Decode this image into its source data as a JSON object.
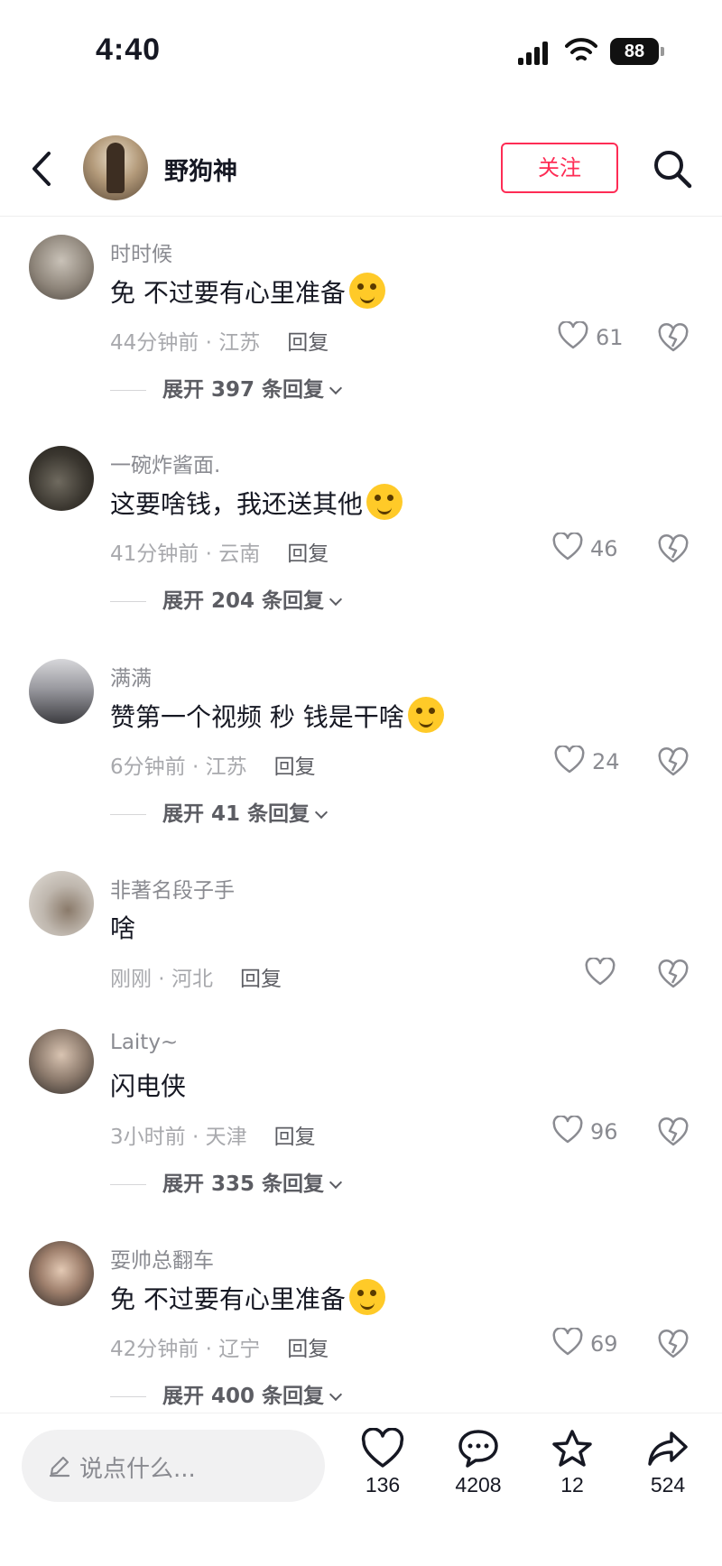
{
  "status_bar": {
    "time": "4:40",
    "battery": "88"
  },
  "header": {
    "title": "野狗神",
    "follow_label": "关注"
  },
  "comments": [
    {
      "username": "时时候",
      "content": "免 不过要有心里准备",
      "emoji": true,
      "time": "44分钟前",
      "location": "江苏",
      "reply_label": "回复",
      "likes": "61",
      "expand_label": "展开 397 条回复"
    },
    {
      "username": "一碗炸酱面.",
      "content": "这要啥钱，我还送其他",
      "emoji": true,
      "time": "41分钟前",
      "location": "云南",
      "reply_label": "回复",
      "likes": "46",
      "expand_label": "展开 204 条回复"
    },
    {
      "username": "满满",
      "content": "赞第一个视频 秒  钱是干啥",
      "emoji": true,
      "time": "6分钟前",
      "location": "江苏",
      "reply_label": "回复",
      "likes": "24",
      "expand_label": "展开 41 条回复"
    },
    {
      "username": "非著名段子手",
      "content": "啥",
      "emoji": false,
      "time": "刚刚",
      "location": "河北",
      "reply_label": "回复",
      "likes": "",
      "expand_label": ""
    },
    {
      "username": "Laity~",
      "content": "闪电侠",
      "emoji": false,
      "time": "3小时前",
      "location": "天津",
      "reply_label": "回复",
      "likes": "96",
      "expand_label": "展开 335 条回复"
    },
    {
      "username": "耍帅总翻车",
      "content": "免 不过要有心里准备",
      "emoji": true,
      "time": "42分钟前",
      "location": "辽宁",
      "reply_label": "回复",
      "likes": "69",
      "expand_label": "展开 400 条回复"
    }
  ],
  "bottom_bar": {
    "input_placeholder": "说点什么...",
    "actions": [
      {
        "icon": "heart-icon",
        "count": "136"
      },
      {
        "icon": "comment-icon",
        "count": "4208"
      },
      {
        "icon": "star-icon",
        "count": "12"
      },
      {
        "icon": "share-icon",
        "count": "524"
      }
    ]
  },
  "colors": {
    "accent": "#fe2c55",
    "secondary_text": "#8a8b91",
    "primary_text": "#161823"
  }
}
